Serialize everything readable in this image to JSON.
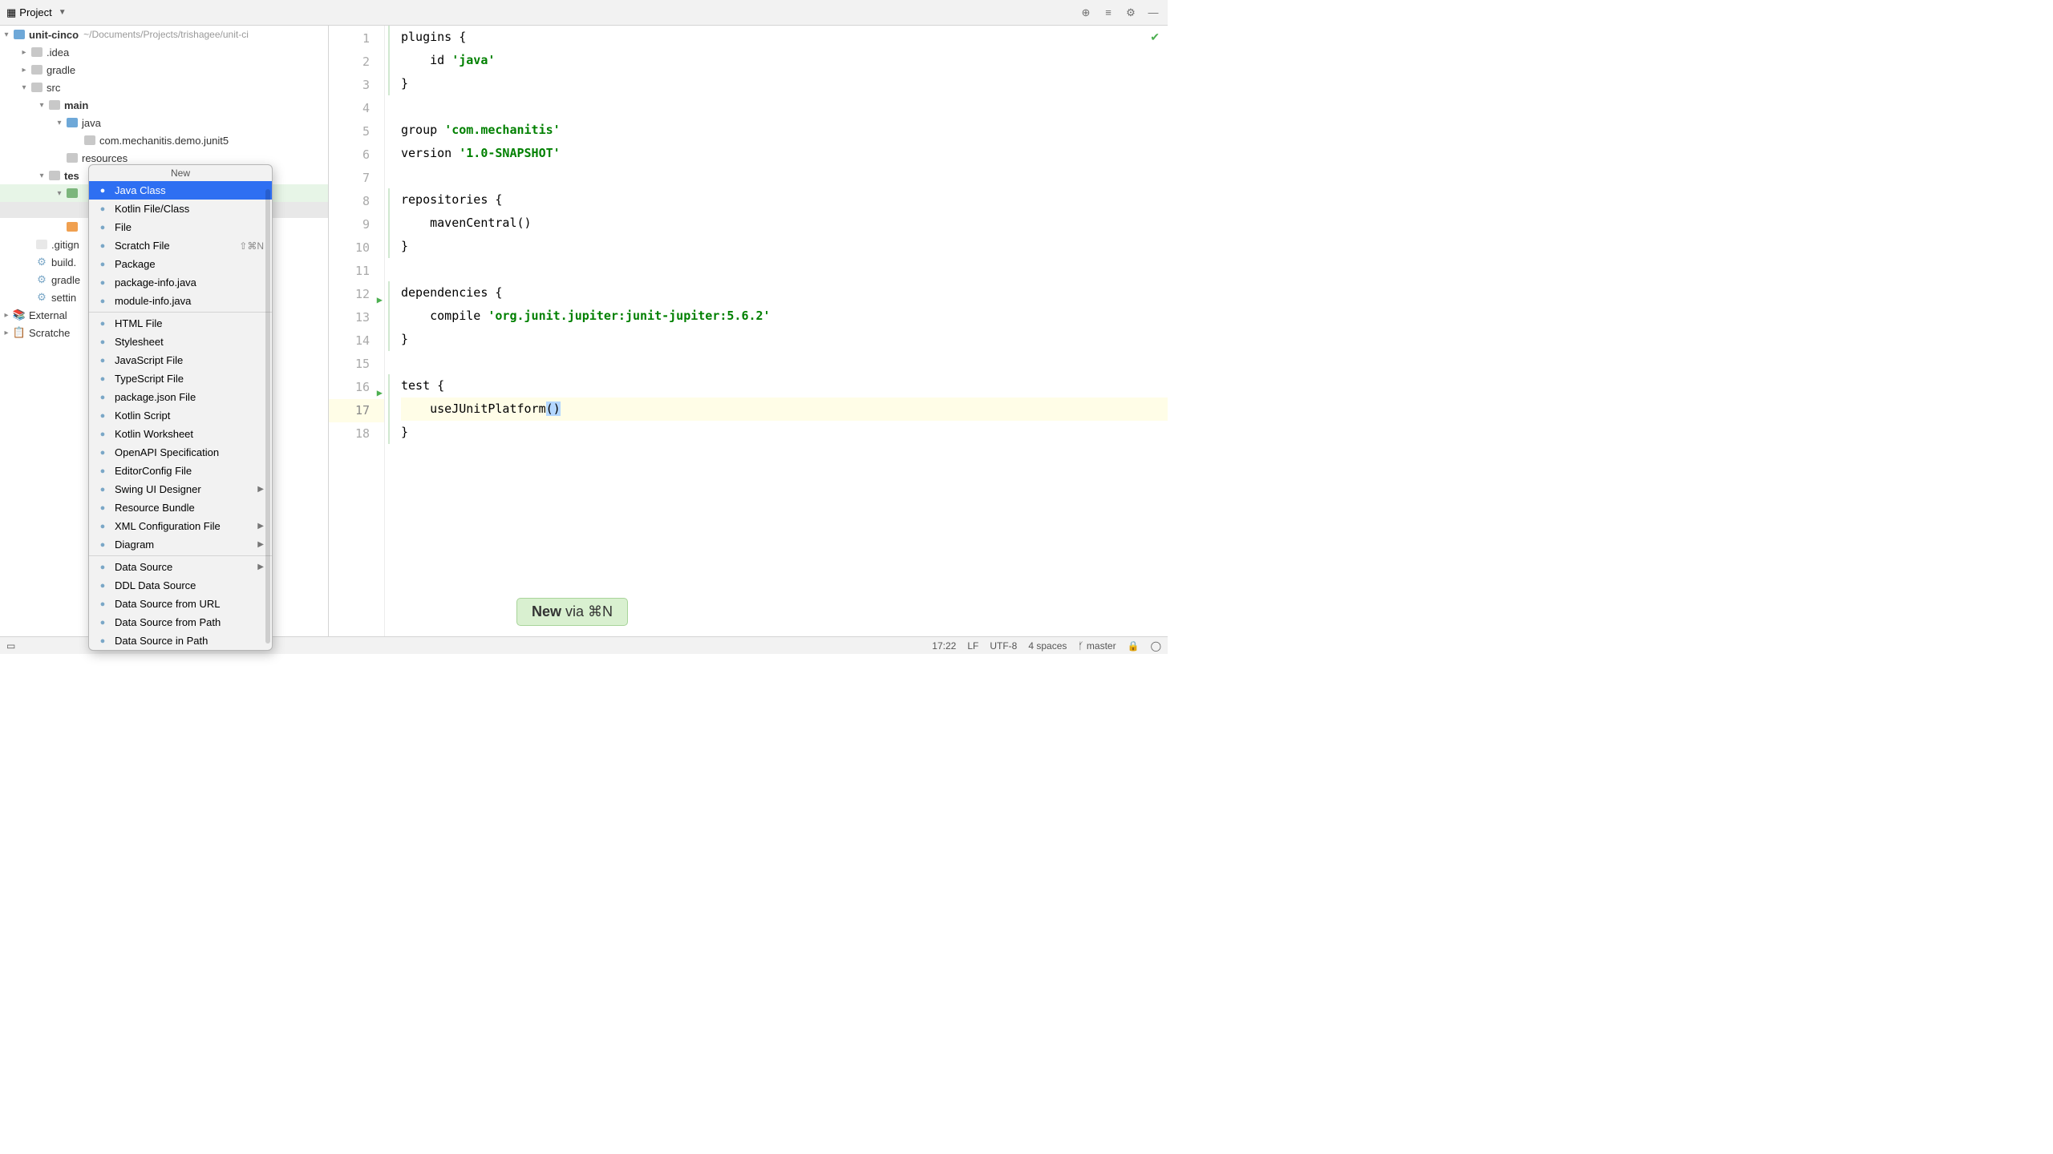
{
  "topbar": {
    "project_label": "Project"
  },
  "tree": {
    "root": {
      "name": "unit-cinco",
      "path": "~/Documents/Projects/trishagee/unit-ci"
    },
    "idea": ".idea",
    "gradle": "gradle",
    "src": "src",
    "main": "main",
    "java_dir": "java",
    "package": "com.mechanitis.demo.junit5",
    "resources": "resources",
    "test": "tes",
    "gitignore": ".gitign",
    "build": "build.",
    "gradle2": "gradle",
    "settings": "settin",
    "external": "External",
    "scratches": "Scratche"
  },
  "popup": {
    "title": "New",
    "items": [
      {
        "label": "Java Class",
        "selected": true
      },
      {
        "label": "Kotlin File/Class"
      },
      {
        "label": "File"
      },
      {
        "label": "Scratch File",
        "shortcut": "⇧⌘N"
      },
      {
        "label": "Package"
      },
      {
        "label": "package-info.java"
      },
      {
        "label": "module-info.java"
      },
      {
        "sep": true
      },
      {
        "label": "HTML File"
      },
      {
        "label": "Stylesheet"
      },
      {
        "label": "JavaScript File"
      },
      {
        "label": "TypeScript File"
      },
      {
        "label": "package.json File"
      },
      {
        "label": "Kotlin Script"
      },
      {
        "label": "Kotlin Worksheet"
      },
      {
        "label": "OpenAPI Specification"
      },
      {
        "label": "EditorConfig File"
      },
      {
        "label": "Swing UI Designer",
        "submenu": true
      },
      {
        "label": "Resource Bundle"
      },
      {
        "label": "XML Configuration File",
        "submenu": true
      },
      {
        "label": "Diagram",
        "submenu": true
      },
      {
        "sep": true
      },
      {
        "label": "Data Source",
        "submenu": true
      },
      {
        "label": "DDL Data Source"
      },
      {
        "label": "Data Source from URL"
      },
      {
        "label": "Data Source from Path"
      },
      {
        "label": "Data Source in Path"
      }
    ]
  },
  "code": {
    "l1_a": "plugins {",
    "l2_a": "    id ",
    "l2_b": "'java'",
    "l3": "}",
    "l4": "",
    "l5_a": "group ",
    "l5_b": "'com.mechanitis'",
    "l6_a": "version ",
    "l6_b": "'1.0-SNAPSHOT'",
    "l7": "",
    "l8": "repositories {",
    "l9": "    mavenCentral()",
    "l10": "}",
    "l11": "",
    "l12": "dependencies {",
    "l13_a": "    compile ",
    "l13_b": "'org.junit.jupiter:junit-jupiter:5.6.2'",
    "l14": "}",
    "l15": "",
    "l16": "test {",
    "l17_a": "    useJUnitPlatform",
    "l17_b": "(",
    "l17_c": ")",
    "l18": "}"
  },
  "tooltip": {
    "bold": "New",
    "rest": " via ⌘N"
  },
  "status": {
    "time": "17:22",
    "lf": "LF",
    "enc": "UTF-8",
    "indent": "4 spaces",
    "branch": "master"
  }
}
